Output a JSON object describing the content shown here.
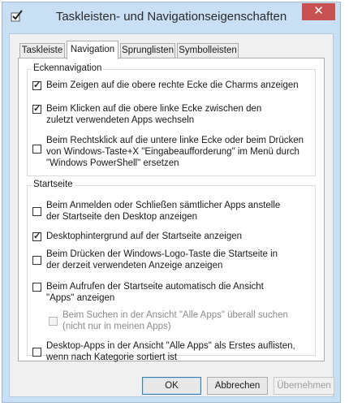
{
  "window": {
    "title": "Taskleisten- und Navigationseigenschaften",
    "close_glyph": "✕",
    "app_icon": "checkbox-icon"
  },
  "tabs": [
    {
      "label": "Taskleiste",
      "active": false
    },
    {
      "label": "Navigation",
      "active": true
    },
    {
      "label": "Sprunglisten",
      "active": false
    },
    {
      "label": "Symbolleisten",
      "active": false
    }
  ],
  "groups": {
    "corner": {
      "title": "Eckennavigation",
      "options": [
        {
          "label": "Beim Zeigen auf die obere rechte Ecke die Charms anzeigen",
          "checked": true,
          "enabled": true
        },
        {
          "label": "Beim Klicken auf die obere linke Ecke zwischen den zuletzt verwendeten Apps wechseln",
          "checked": true,
          "enabled": true
        },
        {
          "label": "Beim Rechtsklick auf die untere linke Ecke oder beim Drücken von Windows-Taste+X \"Eingabeaufforderung\" im Menü durch \"Windows PowerShell\" ersetzen",
          "checked": false,
          "enabled": true
        }
      ]
    },
    "start": {
      "title": "Startseite",
      "options": [
        {
          "label": "Beim Anmelden oder Schließen sämtlicher Apps anstelle der Startseite den Desktop anzeigen",
          "checked": false,
          "enabled": true
        },
        {
          "label": "Desktophintergrund auf der Startseite anzeigen",
          "checked": true,
          "enabled": true
        },
        {
          "label": "Beim Drücken der Windows-Logo-Taste die Startseite in der derzeit verwendeten Anzeige anzeigen",
          "checked": false,
          "enabled": true
        },
        {
          "label": "Beim Aufrufen der Startseite automatisch die Ansicht \"Apps\" anzeigen",
          "checked": false,
          "enabled": true
        },
        {
          "label": "Beim Suchen in der Ansicht \"Alle Apps\" überall suchen (nicht nur in meinen Apps)",
          "checked": false,
          "enabled": false
        },
        {
          "label": "Desktop-Apps in der Ansicht \"Alle Apps\" als Erstes auflisten, wenn nach Kategorie sortiert ist",
          "checked": false,
          "enabled": true
        }
      ]
    }
  },
  "buttons": {
    "ok": "OK",
    "cancel": "Abbrechen",
    "apply": "Übernehmen"
  }
}
